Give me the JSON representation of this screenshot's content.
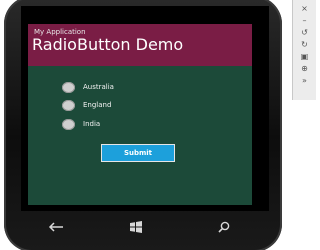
{
  "app": {
    "title": "My Application",
    "page_title": "RadioButton Demo"
  },
  "radio_group": {
    "options": [
      {
        "label": "Australia",
        "selected": false
      },
      {
        "label": "England",
        "selected": false
      },
      {
        "label": "India",
        "selected": false
      }
    ]
  },
  "submit_label": "Submit",
  "hardware_buttons": [
    "back-icon",
    "windows-start-icon",
    "search-icon"
  ],
  "toolbar": {
    "icons": [
      "close-icon",
      "minimize-icon",
      "rotate-left-icon",
      "rotate-right-icon",
      "fit-screen-icon",
      "zoom-icon",
      "more-tools-icon"
    ],
    "glyphs": [
      "×",
      "–",
      "↺",
      "↻",
      "▣",
      "⊕",
      "»"
    ]
  },
  "colors": {
    "header": "#7a1d45",
    "background": "#1c4a39",
    "accent": "#1da0db"
  }
}
